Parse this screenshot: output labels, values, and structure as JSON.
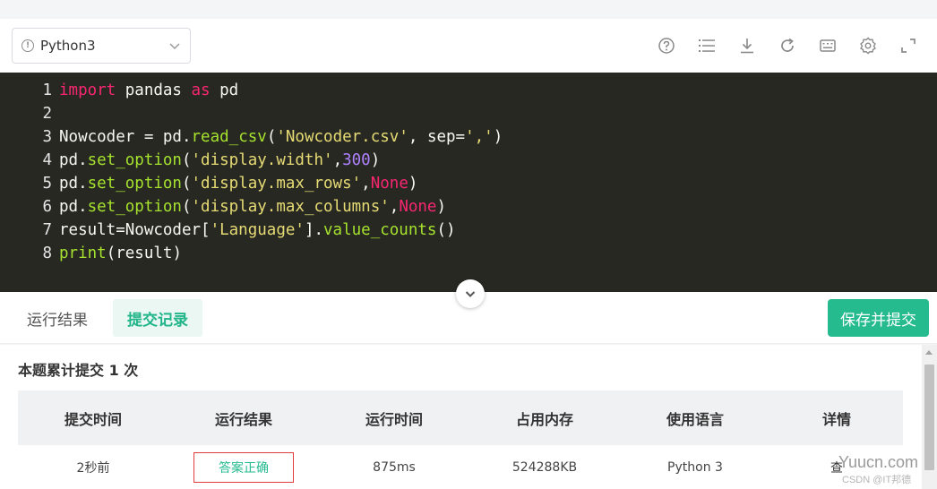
{
  "toolbar": {
    "language": "Python3",
    "icons": [
      "help-icon",
      "list-icon",
      "download-icon",
      "refresh-icon",
      "keyboard-icon",
      "settings-icon",
      "fullscreen-icon"
    ]
  },
  "editor": {
    "line_numbers": [
      "1",
      "2",
      "3",
      "4",
      "5",
      "6",
      "7",
      "8"
    ],
    "lines": [
      "import pandas as pd",
      "",
      "Nowcoder = pd.read_csv('Nowcoder.csv', sep=',')",
      "pd.set_option('display.width',300)",
      "pd.set_option('display.max_rows',None)",
      "pd.set_option('display.max_columns',None)",
      "result=Nowcoder['Language'].value_counts()",
      "print(result)"
    ]
  },
  "tabs": {
    "result_label": "运行结果",
    "record_label": "提交记录"
  },
  "submit_button": "保存并提交",
  "records": {
    "summary": "本题累计提交 1 次",
    "headers": [
      "提交时间",
      "运行结果",
      "运行时间",
      "占用内存",
      "使用语言",
      "详情"
    ],
    "row": {
      "time": "2秒前",
      "status": "答案正确",
      "runtime": "875ms",
      "memory": "524288KB",
      "language": "Python 3",
      "detail": "查"
    }
  },
  "watermark": {
    "main": "Yuucn.com",
    "sub": "CSDN @IT邦德"
  },
  "colors": {
    "accent": "#25bb8e",
    "editor_bg": "#272822",
    "keyword": "#f92672",
    "function": "#a6e22e",
    "string": "#e6db74",
    "number": "#ae81ff",
    "status_border": "#e23b3b"
  }
}
